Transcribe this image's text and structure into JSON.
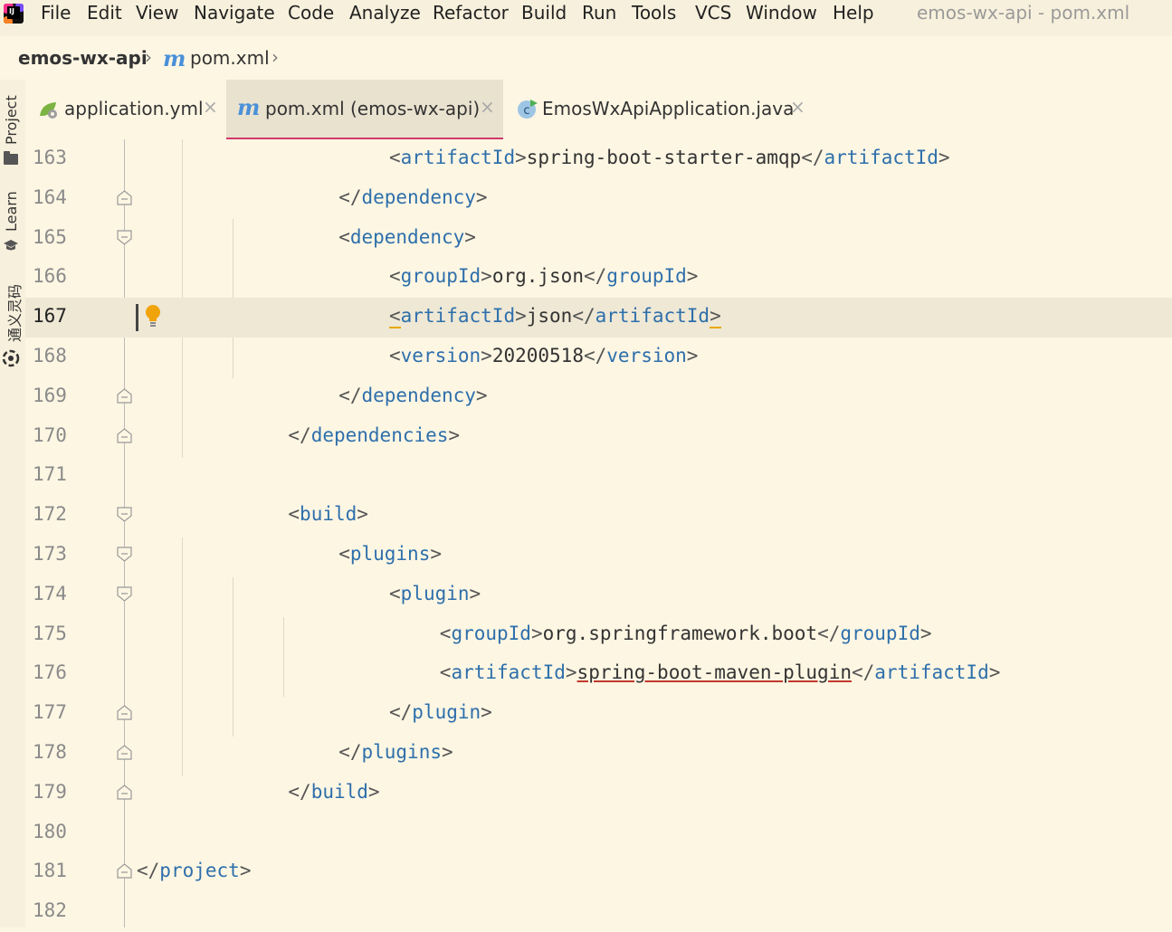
{
  "menu": {
    "items": [
      "File",
      "Edit",
      "View",
      "Navigate",
      "Code",
      "Analyze",
      "Refactor",
      "Build",
      "Run",
      "Tools",
      "VCS",
      "Window",
      "Help"
    ],
    "window_title": "emos-wx-api - pom.xml"
  },
  "breadcrumb": {
    "project": "emos-wx-api",
    "file": "pom.xml"
  },
  "toolstrip": {
    "project": "Project",
    "learn": "Learn",
    "ai": "通义灵码"
  },
  "tabs": [
    {
      "label": "application.yml",
      "icon": "yaml-spring-icon",
      "active": false
    },
    {
      "label": "pom.xml (emos-wx-api)",
      "icon": "maven-icon",
      "active": true
    },
    {
      "label": "EmosWxApiApplication.java",
      "icon": "java-class-icon",
      "active": false
    }
  ],
  "editor": {
    "current_line": 167,
    "lines": [
      {
        "n": "163",
        "pre": "<",
        "tag": "artifactId",
        "mid": ">",
        "text": "spring-boot-starter-amqp",
        "close": "</",
        "ctag": "artifactId",
        "end": ">"
      },
      {
        "n": "164",
        "pre": "</",
        "tag": "dependency",
        "mid": ">"
      },
      {
        "n": "165",
        "pre": "<",
        "tag": "dependency",
        "mid": ">"
      },
      {
        "n": "166",
        "pre": "<",
        "tag": "groupId",
        "mid": ">",
        "text": "org.json",
        "close": "</",
        "ctag": "groupId",
        "end": ">"
      },
      {
        "n": "167",
        "pre": "<",
        "tag": "artifactId",
        "mid": ">",
        "text": "json",
        "close": "</",
        "ctag": "artifactId",
        "end": ">"
      },
      {
        "n": "168",
        "pre": "<",
        "tag": "version",
        "mid": ">",
        "text": "20200518",
        "close": "</",
        "ctag": "version",
        "end": ">"
      },
      {
        "n": "169",
        "pre": "</",
        "tag": "dependency",
        "mid": ">"
      },
      {
        "n": "170",
        "pre": "</",
        "tag": "dependencies",
        "mid": ">"
      },
      {
        "n": "171"
      },
      {
        "n": "172",
        "pre": "<",
        "tag": "build",
        "mid": ">"
      },
      {
        "n": "173",
        "pre": "<",
        "tag": "plugins",
        "mid": ">"
      },
      {
        "n": "174",
        "pre": "<",
        "tag": "plugin",
        "mid": ">"
      },
      {
        "n": "175",
        "pre": "<",
        "tag": "groupId",
        "mid": ">",
        "text": "org.springframework.boot",
        "close": "</",
        "ctag": "groupId",
        "end": ">"
      },
      {
        "n": "176",
        "pre": "<",
        "tag": "artifactId",
        "mid": ">",
        "text": "spring-boot-maven-plugin",
        "close": "</",
        "ctag": "artifactId",
        "end": ">"
      },
      {
        "n": "177",
        "pre": "</",
        "tag": "plugin",
        "mid": ">"
      },
      {
        "n": "178",
        "pre": "</",
        "tag": "plugins",
        "mid": ">"
      },
      {
        "n": "179",
        "pre": "</",
        "tag": "build",
        "mid": ">"
      },
      {
        "n": "180"
      },
      {
        "n": "181",
        "pre": "</",
        "tag": "project",
        "mid": ">"
      },
      {
        "n": "182"
      }
    ]
  },
  "colors": {
    "background": "#fdf6e3",
    "tag": "#2e6fab",
    "active_tab_underline": "#d0396b",
    "current_line": "#eee8d5"
  }
}
